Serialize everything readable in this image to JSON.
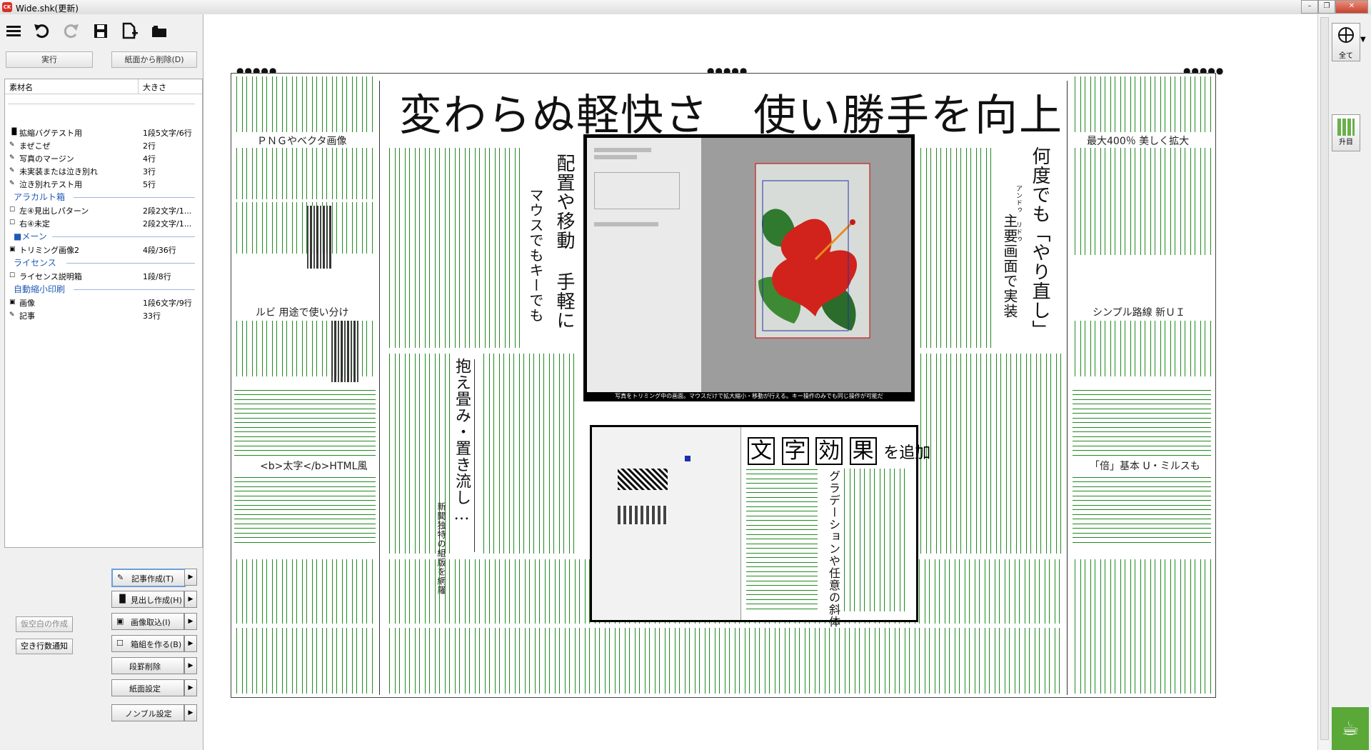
{
  "window": {
    "title": "Wide.shk(更新)",
    "app_icon": "CK"
  },
  "toolbar": {
    "run_label": "実行",
    "remove_label": "紙面から削除(D)"
  },
  "list": {
    "col_name": "素材名",
    "col_size": "大きさ",
    "rows1": [
      {
        "icon": "headline",
        "name": "拡縮バグテスト用",
        "size": "1段5文字/6行"
      },
      {
        "icon": "article",
        "name": "まぜこぜ",
        "size": "2行"
      },
      {
        "icon": "article",
        "name": "写真のマージン",
        "size": "4行"
      },
      {
        "icon": "article",
        "name": "未実装または泣き別れ",
        "size": "3行"
      },
      {
        "icon": "article",
        "name": "泣き別れテスト用",
        "size": "5行"
      }
    ],
    "group1": "アラカルト箱",
    "rows2": [
      {
        "icon": "box",
        "name": "左④見出しパターン",
        "size": "2段2文字/1..."
      },
      {
        "icon": "box",
        "name": "右④未定",
        "size": "2段2文字/1..."
      }
    ],
    "group2": "■メーン",
    "rows3": [
      {
        "icon": "image",
        "name": "トリミング画像2",
        "size": "4段/36行"
      }
    ],
    "group3": "ライセンス",
    "rows4": [
      {
        "icon": "box",
        "name": "ライセンス説明箱",
        "size": "1段/8行"
      }
    ],
    "group4": "自動縮小印刷",
    "rows5": [
      {
        "icon": "image",
        "name": "画像",
        "size": "1段6文字/9行"
      },
      {
        "icon": "article",
        "name": "記事",
        "size": "33行"
      }
    ]
  },
  "actions": {
    "create_article": "記事作成(T)",
    "create_headline": "見出し作成(H)",
    "import_image": "画像取込(I)",
    "make_box": "箱組を作る(B)",
    "delete_column": "段罫削除",
    "paper_settings": "紙面設定",
    "nombre_settings": "ノンブル設定"
  },
  "side_buttons": {
    "blank": "仮空白の作成",
    "empty_lines": "空き行数通知"
  },
  "right_panel": {
    "all_label": "全て",
    "ascend_label": "升目"
  },
  "page": {
    "headline": "変わらぬ軽快さ　使い勝手を向上",
    "dots_left": "●●●●●",
    "dots_center": "●●●●●",
    "dots_right": "●●●●●",
    "label_png": "ＰＮＧやベクタ画像",
    "label_ruby": "ルビ 用途で使い分け",
    "label_html": "<b>太字</b>HTML風",
    "label_zoom": "最大400％ 美しく拡大",
    "label_simple": "シンプル路線 新ＵＩ",
    "label_base": "「倍」基本 U・ミルスも",
    "vert_place": "配置や移動 手軽に",
    "vert_mouse": "マウスでもキーでも",
    "vert_redo": "何度でも「やり直し」",
    "vert_redo_ruby": "アンドゥ リドゥ",
    "vert_main": "主要画面で実装",
    "vert_fold": "抱え畳み・置き流し…",
    "vert_fold_sub": "新聞独特の組版を網羅",
    "vert_grad": "グラデーションや任意の斜体",
    "effect_title": [
      "文",
      "字",
      "効",
      "果"
    ],
    "effect_suffix": "を追加",
    "photo_caption": "写真をトリミング中の画面。マウスだけで拡大縮小・移動が行える。キー操作のみでも同じ操作が可能だ"
  }
}
